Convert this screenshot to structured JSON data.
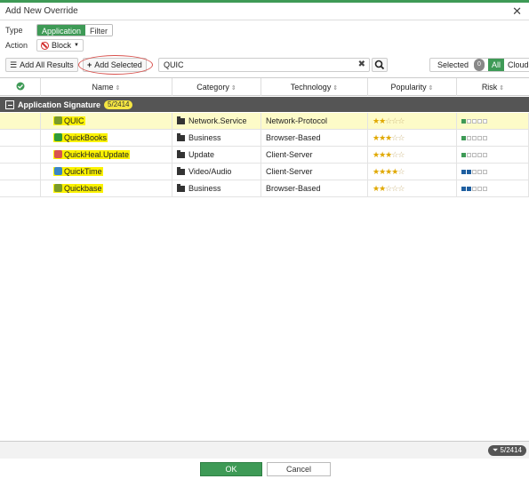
{
  "dialog": {
    "title": "Add New Override"
  },
  "form": {
    "type_label": "Type",
    "type_options": [
      "Application",
      "Filter"
    ],
    "type_selected": "Application",
    "action_label": "Action",
    "action_value": "Block"
  },
  "toolbar": {
    "add_all_label": "Add All Results",
    "add_selected_label": "Add Selected",
    "search_value": "QUIC",
    "filter_selected_label": "Selected",
    "filter_selected_count": "0",
    "filter_all_label": "All",
    "filter_cloud_label": "Cloud"
  },
  "table": {
    "columns": [
      "Name",
      "Category",
      "Technology",
      "Popularity",
      "Risk"
    ],
    "group": {
      "label": "Application Signature",
      "badge": "5/2414"
    },
    "rows": [
      {
        "name": "QUIC",
        "category": "Network.Service",
        "technology": "Network-Protocol",
        "popularity": 2,
        "risk": 1,
        "risk_color": "#3e9a56",
        "icon_color": "#7a9a2a",
        "selected": true
      },
      {
        "name": "QuickBooks",
        "category": "Business",
        "technology": "Browser-Based",
        "popularity": 3,
        "risk": 1,
        "risk_color": "#3e9a56",
        "icon_color": "#2e9a3a",
        "selected": false
      },
      {
        "name": "QuickHeal.Update",
        "category": "Update",
        "technology": "Client-Server",
        "popularity": 3,
        "risk": 1,
        "risk_color": "#3e9a56",
        "icon_color": "#d9534f",
        "selected": false
      },
      {
        "name": "QuickTime",
        "category": "Video/Audio",
        "technology": "Client-Server",
        "popularity": 4,
        "risk": 2,
        "risk_color": "#1f5fa0",
        "icon_color": "#3a86c8",
        "selected": false
      },
      {
        "name": "Quickbase",
        "category": "Business",
        "technology": "Browser-Based",
        "popularity": 2,
        "risk": 2,
        "risk_color": "#1f5fa0",
        "icon_color": "#7a9a2a",
        "selected": false
      }
    ]
  },
  "status": {
    "count": "5/2414"
  },
  "footer": {
    "ok_label": "OK",
    "cancel_label": "Cancel"
  },
  "colors": {
    "accent": "#3e9a56",
    "highlight": "#fbf200",
    "group_bar": "#555555"
  }
}
